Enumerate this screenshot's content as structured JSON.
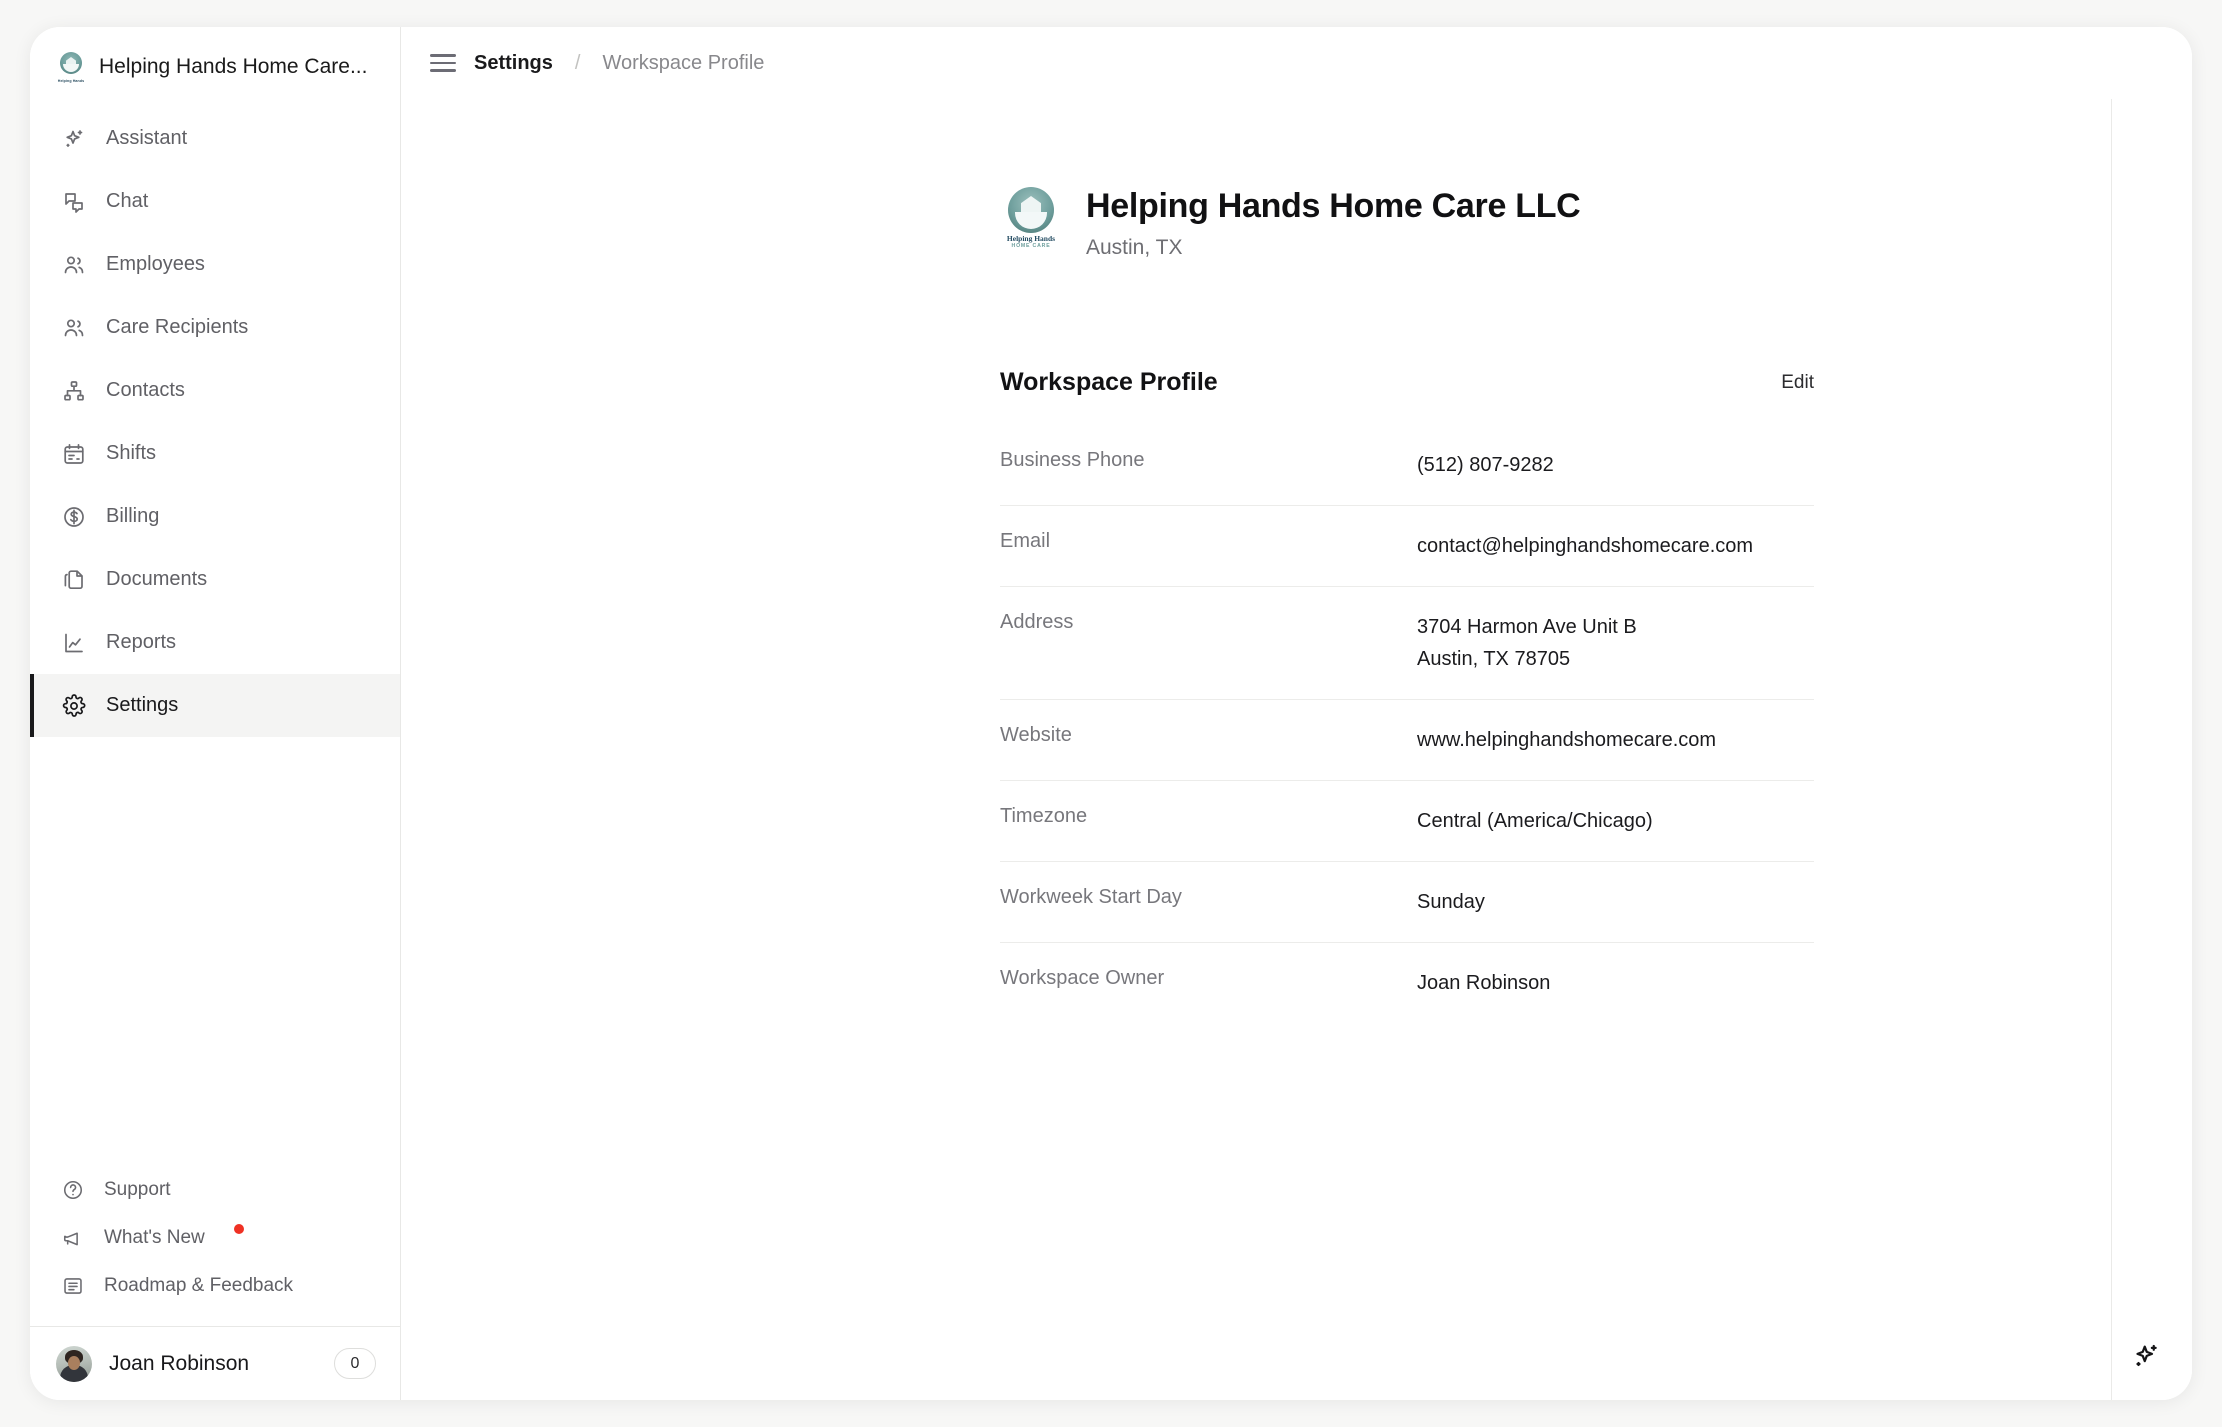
{
  "sidebar": {
    "workspace_title": "Helping Hands Home Care...",
    "logo_text_line1": "Helping Hands",
    "logo_text_line2": "HOME CARE",
    "nav": [
      {
        "label": "Assistant",
        "icon": "sparkle-icon"
      },
      {
        "label": "Chat",
        "icon": "chat-bubbles-icon"
      },
      {
        "label": "Employees",
        "icon": "users-icon"
      },
      {
        "label": "Care Recipients",
        "icon": "users-icon"
      },
      {
        "label": "Contacts",
        "icon": "org-chart-icon"
      },
      {
        "label": "Shifts",
        "icon": "calendar-icon"
      },
      {
        "label": "Billing",
        "icon": "dollar-circle-icon"
      },
      {
        "label": "Documents",
        "icon": "documents-icon"
      },
      {
        "label": "Reports",
        "icon": "chart-icon"
      },
      {
        "label": "Settings",
        "icon": "gear-icon"
      }
    ],
    "active_nav": "Settings",
    "bottom_nav": [
      {
        "label": "Support",
        "icon": "question-circle-icon",
        "has_dot": false
      },
      {
        "label": "What's New",
        "icon": "megaphone-icon",
        "has_dot": true
      },
      {
        "label": "Roadmap & Feedback",
        "icon": "list-document-icon",
        "has_dot": false
      }
    ],
    "user": {
      "name": "Joan Robinson",
      "badge_count": "0"
    }
  },
  "topbar": {
    "menu_icon": "hamburger-icon",
    "breadcrumb_current": "Settings",
    "breadcrumb_separator": "/",
    "breadcrumb_sub": "Workspace Profile"
  },
  "org": {
    "name": "Helping Hands Home Care LLC",
    "location": "Austin, TX",
    "logo_text_line1": "Helping Hands",
    "logo_text_line2": "HOME CARE"
  },
  "panel": {
    "title": "Workspace Profile",
    "edit_label": "Edit",
    "rows": [
      {
        "label": "Business Phone",
        "value": "(512) 807-9282",
        "value2": ""
      },
      {
        "label": "Email",
        "value": "contact@helpinghandshomecare.com",
        "value2": ""
      },
      {
        "label": "Address",
        "value": "3704 Harmon Ave Unit B",
        "value2": "Austin, TX 78705"
      },
      {
        "label": "Website",
        "value": "www.helpinghandshomecare.com",
        "value2": ""
      },
      {
        "label": "Timezone",
        "value": "Central (America/Chicago)",
        "value2": ""
      },
      {
        "label": "Workweek Start Day",
        "value": "Sunday",
        "value2": ""
      },
      {
        "label": "Workspace Owner",
        "value": "Joan Robinson",
        "value2": ""
      }
    ]
  },
  "fab": {
    "icon": "sparkle-icon"
  },
  "colors": {
    "accent_notification": "#ef3124",
    "active_indicator": "#19191b",
    "brand_teal": "#6d9e9c",
    "page_background": "#f7f7f6"
  }
}
